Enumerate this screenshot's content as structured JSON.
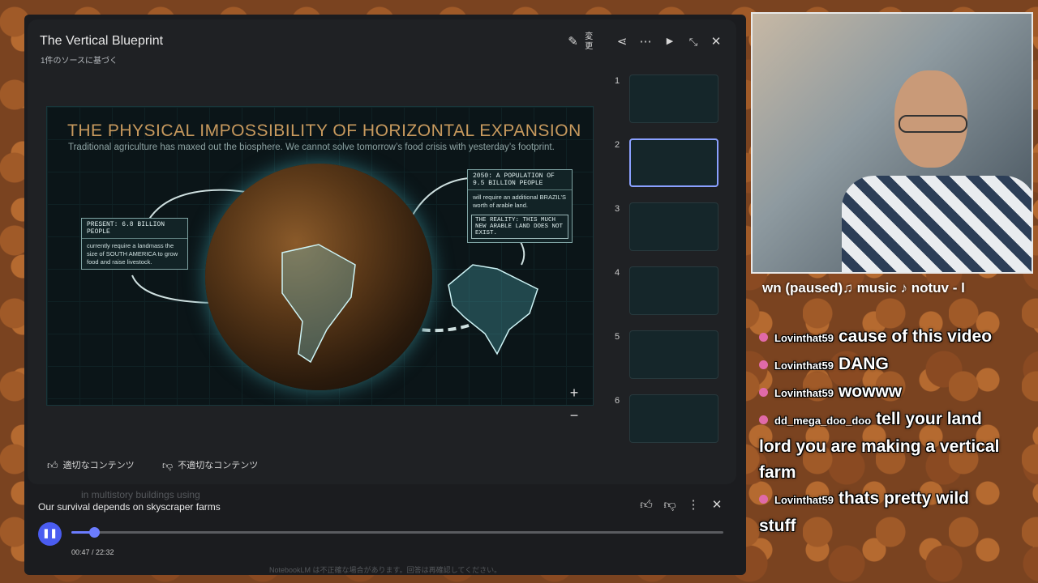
{
  "notebook": {
    "title": "The Vertical Blueprint",
    "subtitle": "1件のソースに基づく",
    "edit_label": "変更"
  },
  "slide": {
    "title": "THE PHYSICAL IMPOSSIBILITY OF HORIZONTAL EXPANSION",
    "subtitle": "Traditional agriculture has maxed out the biosphere. We cannot solve tomorrow’s food crisis with yesterday’s footprint.",
    "left_box": {
      "heading": "PRESENT: 6.8 BILLION PEOPLE",
      "body": "currently require a landmass the size of SOUTH AMERICA to grow food and raise livestock."
    },
    "right_box": {
      "heading": "2050: A POPULATION OF 9.5 BILLION PEOPLE",
      "body": "will require an additional BRAZIL’S worth of arable land.",
      "reality": "THE REALITY: THIS MUCH NEW ARABLE LAND DOES NOT EXIST."
    },
    "zoom_in": "+",
    "zoom_out": "−"
  },
  "thumbnails": [
    {
      "num": "1"
    },
    {
      "num": "2"
    },
    {
      "num": "3"
    },
    {
      "num": "4"
    },
    {
      "num": "5"
    },
    {
      "num": "6"
    }
  ],
  "active_thumbnail": 2,
  "feedback": {
    "good": "適切なコンテンツ",
    "bad": "不適切なコンテンツ"
  },
  "player": {
    "title": "Our survival depends on skyscraper farms",
    "current": "00:47",
    "total": "22:32",
    "time_text": "00:47 / 22:32",
    "progress": 0.035
  },
  "ghost_text": {
    "multistory": "in multistory buildings using",
    "footer": "NotebookLM は不正確な場合があります。回答は再確認してください。"
  },
  "stream": {
    "now_playing": "wn        (paused)♫ music ♪ notuv - l",
    "chat": [
      {
        "user": "",
        "text": "cause of this video",
        "continuation": true
      },
      {
        "user": "Lovinthat59",
        "text": "DANG"
      },
      {
        "user": "Lovinthat59",
        "text": "wowww"
      },
      {
        "user": "dd_mega_doo_doo",
        "text": "tell your land lord you are making a vertical farm"
      },
      {
        "user": "Lovinthat59",
        "text": "thats pretty wild stuff"
      }
    ]
  },
  "colors": {
    "accent": "#4a5cf0",
    "slide_title": "#c89a5e",
    "chat_avatar": "#e06aa8"
  }
}
